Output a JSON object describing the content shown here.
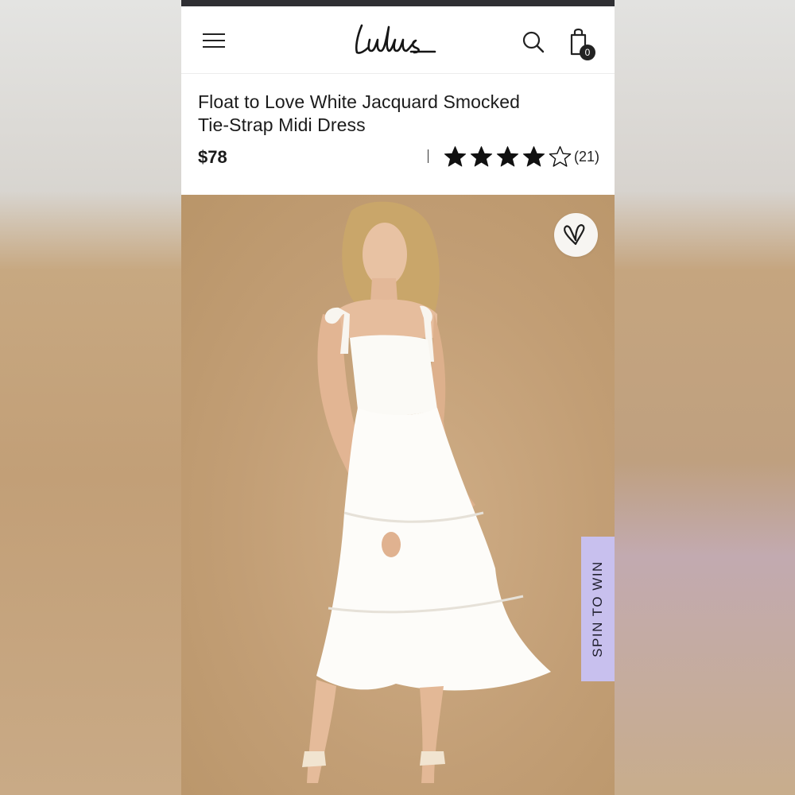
{
  "header": {
    "brand": "Lulus",
    "cart_count": "0"
  },
  "product": {
    "title_line1": "Float to Love White Jacquard Smocked",
    "title_line2": "Tie-Strap Midi Dress",
    "price": "$78",
    "rating": 4,
    "rating_max": 5,
    "review_count": "(21)"
  },
  "promo": {
    "spin_label": "SPIN TO WIN"
  },
  "colors": {
    "accent_tab": "#c8c0ee",
    "hero_background": "#c29e75",
    "text": "#1b1b1b"
  },
  "icons": [
    "menu-icon",
    "search-icon",
    "shopping-bag-icon",
    "heart-icon",
    "star-icon"
  ]
}
